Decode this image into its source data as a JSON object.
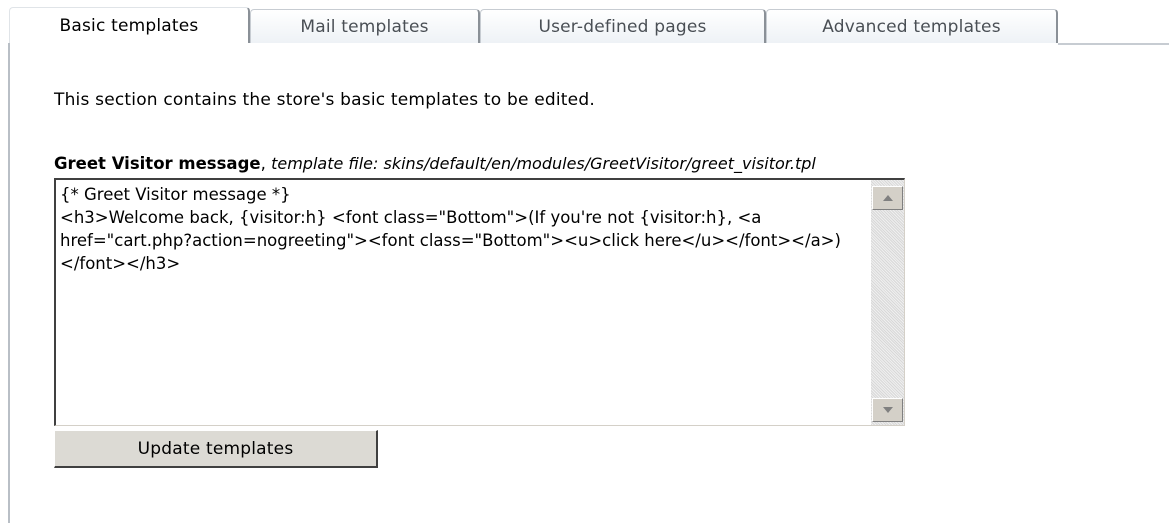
{
  "tabs": [
    {
      "label": "Basic templates",
      "active": true
    },
    {
      "label": "Mail templates",
      "active": false
    },
    {
      "label": "User-defined pages",
      "active": false
    },
    {
      "label": "Advanced templates",
      "active": false
    }
  ],
  "panel": {
    "intro_text": "This section contains the store's basic templates to be edited.",
    "field": {
      "name": "Greet Visitor message",
      "separator": ", ",
      "file_label": "template file: skins/default/en/modules/GreetVisitor/greet_visitor.tpl",
      "value": "{* Greet Visitor message *}\n<h3>Welcome back, {visitor:h} <font class=\"Bottom\">(If you're not {visitor:h}, <a href=\"cart.php?action=nogreeting\"><font class=\"Bottom\"><u>click here</u></font></a>)</font></h3>"
    },
    "update_button_label": "Update templates"
  },
  "colors": {
    "tab_border": "#c7ccd2",
    "button_face": "#dcdad4",
    "scrollbar_face": "#d4d0c8"
  },
  "icons": {
    "scroll_up": "scroll-up-arrow-icon",
    "scroll_down": "scroll-down-arrow-icon"
  }
}
